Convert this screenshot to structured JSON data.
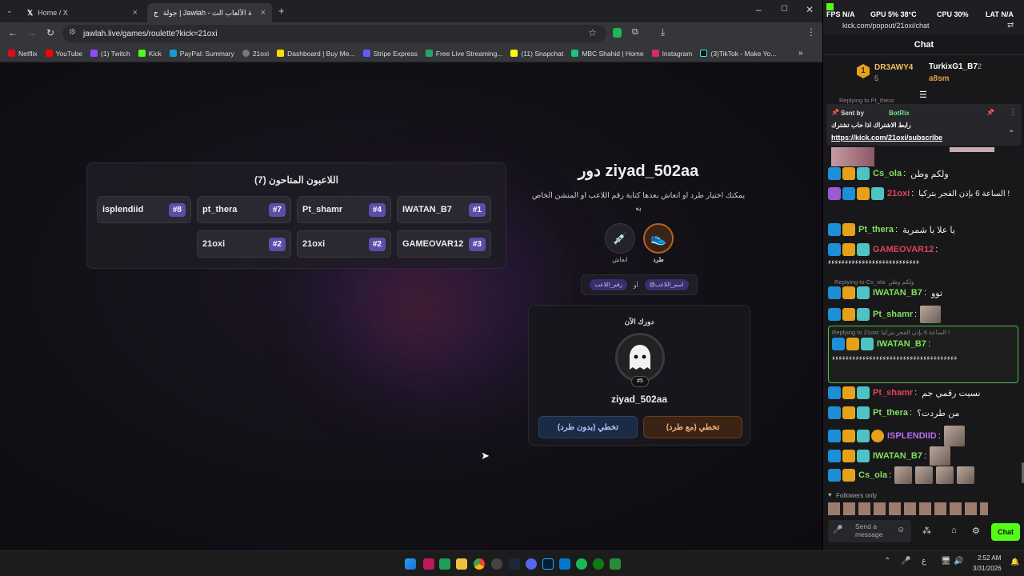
{
  "browser": {
    "tabs": [
      {
        "title": "Home / X"
      },
      {
        "title": "جولة | Jawlah - منصة الألعاب الت..."
      }
    ],
    "url": "jawlah.live/games/roulette?kick=21oxi",
    "bookmarks": [
      "Netflix",
      "YouTube",
      "(1) Twitch",
      "Kick",
      "PayPal: Summary",
      "21oxi",
      "Dashboard | Buy Me...",
      "Stripe Express",
      "Free Live Streaming...",
      "(11) Snapchat",
      "MBC Shahid | Home",
      "Instagram",
      "(3)TikTok - Make Yo..."
    ]
  },
  "game": {
    "players_title": "اللاعبون المتاحون (7)",
    "players": [
      {
        "name": "IWATAN_B7",
        "num": "#1"
      },
      {
        "name": "Pt_shamr",
        "num": "#4"
      },
      {
        "name": "pt_thera",
        "num": "#7"
      },
      {
        "name": "isplendiid",
        "num": "#8"
      },
      {
        "name": "GAMEOVAR12",
        "num": "#3"
      },
      {
        "name": "21oxi",
        "num": "#2"
      },
      {
        "name": "21oxi",
        "num": "#2"
      }
    ],
    "turn_title": "دور ziyad_502aa",
    "turn_desc": "يمكنك اختيار طرد او انعاش بعدها كتابة رقم اللاعب او المنشن الخاص به",
    "actions": {
      "kick": "طرد",
      "revive": "انعاش"
    },
    "hint": {
      "name_pill": "@اسم_اللاعب",
      "or": "أو",
      "num_pill": "رقم_اللاعب"
    },
    "now": {
      "label": "دورك الآن",
      "badge": "#5",
      "name": "ziyad_502aa"
    },
    "buttons": {
      "skip_kick": "تخطي (مع طرد)",
      "skip_nokick": "تخطي (بدون طرد)"
    }
  },
  "overlay": {
    "fps": "FPS N/A",
    "gpu": "GPU 5% 38°C",
    "cpu": "CPU 30%",
    "lat": "LAT N/A",
    "url": "kick.com/popout/21oxi/chat"
  },
  "chat": {
    "header": "Chat",
    "leaderboard": [
      {
        "rank": "1",
        "name": "DR3AWY4",
        "count": "5"
      },
      {
        "rank": "",
        "name": "TurkixG1_B7",
        "count": "2"
      },
      {
        "rank": "",
        "name": "a8sm",
        "count": ""
      }
    ],
    "pinned": {
      "sent_by": "Sent by",
      "bot": "BotRix",
      "text": "رابط الاشتراك اذا حاب تشترك",
      "link": "https://kick.com/21oxi/subscribe",
      "replying_top": "Replying to Pt_thera:"
    },
    "messages": [
      {
        "user": "Cs_ola",
        "color": "#7fe05a",
        "text": "ولكم وطن"
      },
      {
        "user": "21oxi",
        "color": "#e0435a",
        "text": "الساعة 6 بإذن الفجر بتركيا !"
      },
      {
        "user": "Pt_thera",
        "color": "#7fe05a",
        "text": "يا علا يا شمرية"
      },
      {
        "user": "GAMEOVAR12",
        "color": "#e0435a",
        "text": "ءءءءءءءءءءءءءءءءءءءءءءءءءءء"
      },
      {
        "user": "IWATAN_B7",
        "color": "#7fe05a",
        "text": "توو",
        "reply": "Replying to Cs_ola: ولكم وطن"
      },
      {
        "user": "Pt_shamr",
        "color": "#7fe05a",
        "text": ""
      },
      {
        "user": "IWATAN_B7",
        "color": "#7fe05a",
        "text": "ءءءءءءءءءءءءءءءءءءءءءءءءءءءءءءءءءءءءء",
        "reply": "Replying to 21oxi: الساعة 6 بإذن الفجر بتركيا !"
      },
      {
        "user": "Pt_shamr",
        "color": "#e0435a",
        "text": "نسيت رقمي جم"
      },
      {
        "user": "Pt_thera",
        "color": "#7fe05a",
        "text": "من طردت؟"
      },
      {
        "user": "ISPLENDIID",
        "color": "#b46cf0",
        "text": ""
      },
      {
        "user": "IWATAN_B7",
        "color": "#7fe05a",
        "text": ""
      },
      {
        "user": "Cs_ola",
        "color": "#7fe05a",
        "text": ""
      }
    ],
    "followers_only": "Followers only",
    "input_placeholder": "Send a message",
    "send_label": "Chat"
  },
  "taskbar": {
    "time": "2:52 AM",
    "date": "3/31/2026"
  }
}
